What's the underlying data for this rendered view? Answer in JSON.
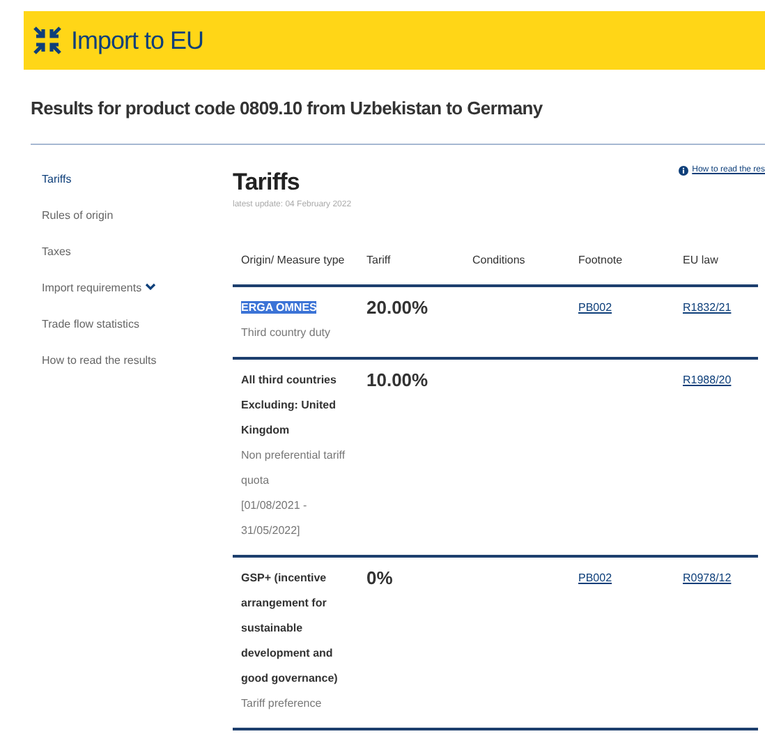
{
  "header": {
    "title": "Import to EU"
  },
  "results_title": "Results for product code 0809.10 from Uzbekistan to Germany",
  "sidebar": {
    "items": [
      {
        "label": "Tariffs",
        "selected": true,
        "expandable": false
      },
      {
        "label": "Rules of origin",
        "selected": false,
        "expandable": false
      },
      {
        "label": "Taxes",
        "selected": false,
        "expandable": false
      },
      {
        "label": "Import requirements",
        "selected": false,
        "expandable": true
      },
      {
        "label": "Trade flow statistics",
        "selected": false,
        "expandable": false
      },
      {
        "label": "How to read the results",
        "selected": false,
        "expandable": false
      }
    ]
  },
  "main": {
    "title": "Tariffs",
    "update": "latest update: 04 February 2022",
    "help_link": "How to read the res",
    "table": {
      "columns": [
        "Origin/ Measure type",
        "Tariff",
        "Conditions",
        "Footnote",
        "EU law"
      ],
      "rows": [
        {
          "origin": "ERGA OMNES",
          "origin_highlighted": true,
          "measure": "Third country duty",
          "period": "",
          "tariff": "20.00%",
          "conditions": "",
          "footnote": "PB002",
          "eu_law": "R1832/21"
        },
        {
          "origin": "All third countries Excluding: United Kingdom",
          "origin_highlighted": false,
          "measure": "Non preferential tariff quota",
          "period": "[01/08/2021 - 31/05/2022]",
          "tariff": "10.00%",
          "conditions": "",
          "footnote": "",
          "eu_law": "R1988/20"
        },
        {
          "origin": "GSP+ (incentive arrangement for sustainable development and good governance)",
          "origin_highlighted": false,
          "measure": "Tariff preference",
          "period": "",
          "tariff": "0%",
          "conditions": "",
          "footnote": "PB002",
          "eu_law": "R0978/12"
        }
      ]
    }
  }
}
